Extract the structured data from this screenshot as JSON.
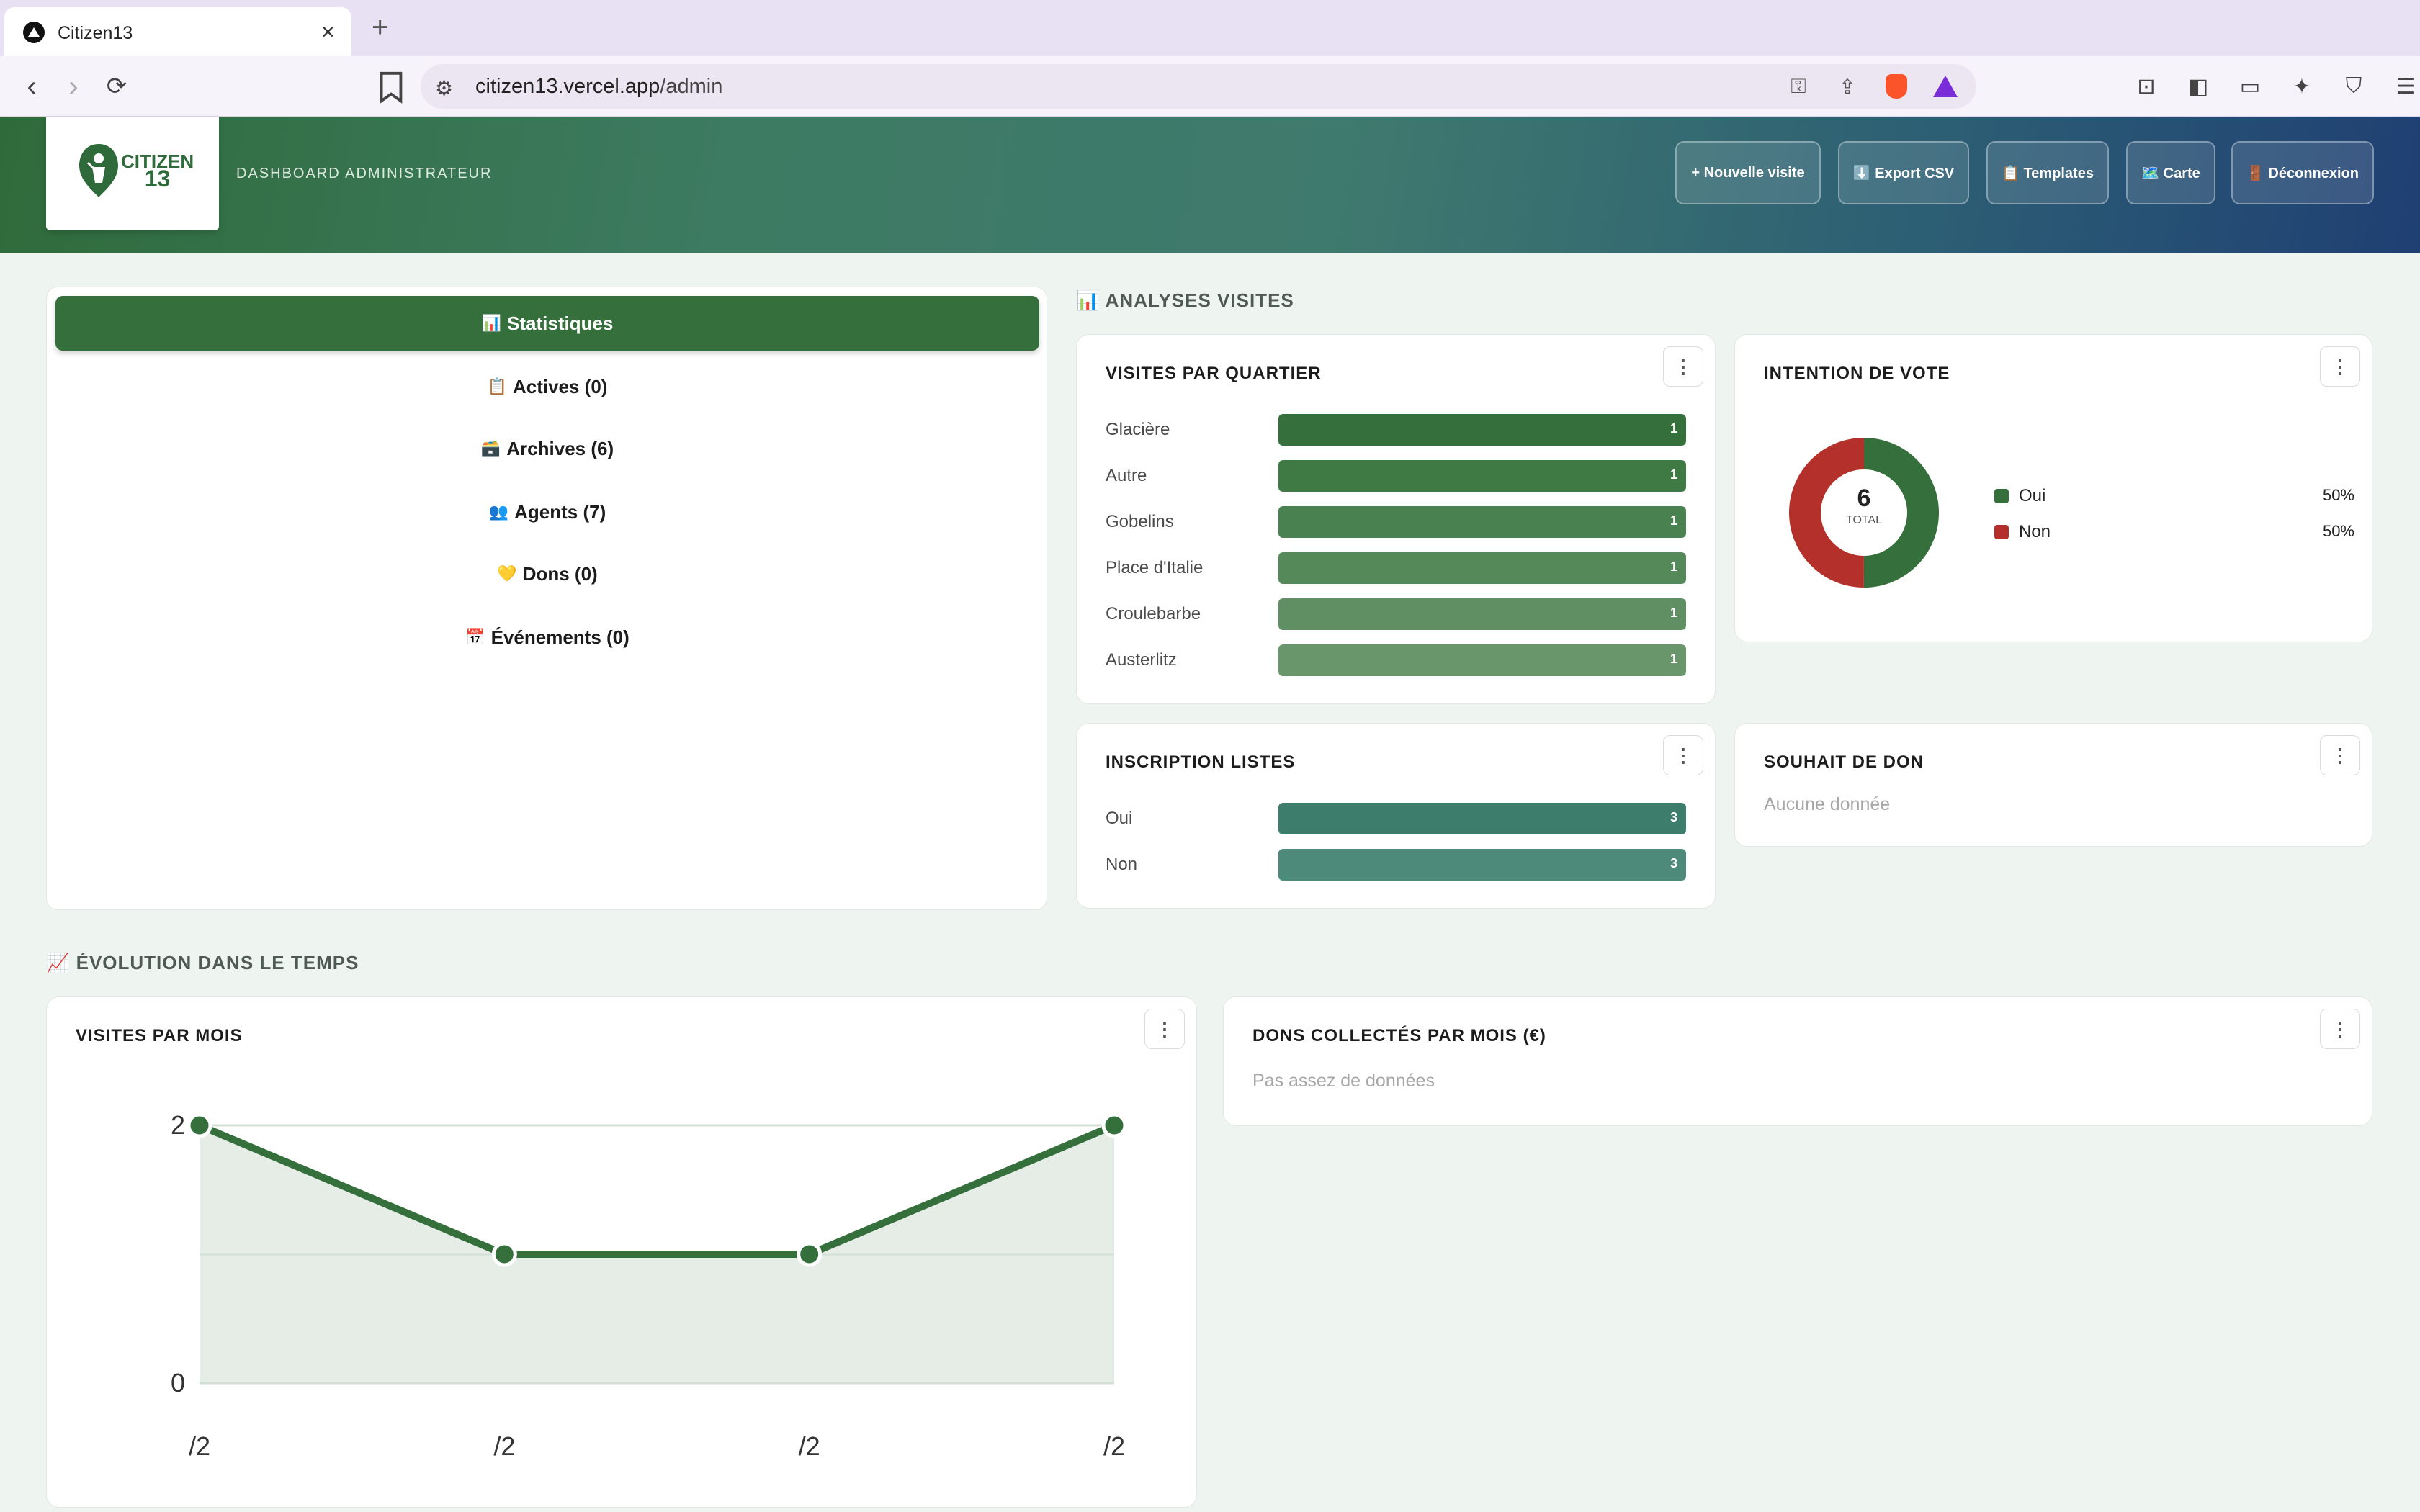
{
  "browser": {
    "tab_title": "Citizen13",
    "url_host": "citizen13.vercel.app",
    "url_path": "/admin"
  },
  "header": {
    "logo_line1": "CITIZEN",
    "logo_line2": "13",
    "subtitle": "DASHBOARD ADMINISTRATEUR",
    "buttons": [
      {
        "label": "+ Nouvelle visite"
      },
      {
        "label": "⬇️ Export CSV"
      },
      {
        "label": "📋 Templates"
      },
      {
        "label": "🗺️ Carte"
      },
      {
        "label": "🚪 Déconnexion"
      }
    ]
  },
  "sidebar": {
    "items": [
      {
        "icon": "📊",
        "label": "Statistiques",
        "active": true
      },
      {
        "icon": "📋",
        "label": "Actives (0)"
      },
      {
        "icon": "🗃️",
        "label": "Archives (6)"
      },
      {
        "icon": "👥",
        "label": "Agents (7)"
      },
      {
        "icon": "💛",
        "label": "Dons (0)"
      },
      {
        "icon": "📅",
        "label": "Événements (0)"
      }
    ]
  },
  "analyses": {
    "icon": "📊",
    "title": "ANALYSES VISITES",
    "visites_quartier": {
      "title": "VISITES PAR QUARTIER",
      "rows": [
        {
          "label": "Glacière",
          "value": 1,
          "color": "#35703c"
        },
        {
          "label": "Autre",
          "value": 1,
          "color": "#3f7a45"
        },
        {
          "label": "Gobelins",
          "value": 1,
          "color": "#4a8150"
        },
        {
          "label": "Place d'Italie",
          "value": 1,
          "color": "#55895a"
        },
        {
          "label": "Croulebarbe",
          "value": 1,
          "color": "#5f8f63"
        },
        {
          "label": "Austerlitz",
          "value": 1,
          "color": "#6a966c"
        }
      ]
    },
    "intention_vote": {
      "title": "INTENTION DE VOTE",
      "total": "6",
      "total_label": "TOTAL",
      "slices": [
        {
          "label": "Oui",
          "pct": "50%",
          "value": 50,
          "color": "#35703c"
        },
        {
          "label": "Non",
          "pct": "50%",
          "value": 50,
          "color": "#b3302b"
        }
      ]
    },
    "inscription_listes": {
      "title": "INSCRIPTION LISTES",
      "rows": [
        {
          "label": "Oui",
          "value": 3,
          "color": "#3c7d6c"
        },
        {
          "label": "Non",
          "value": 3,
          "color": "#4d8a7a"
        }
      ]
    },
    "souhait_don": {
      "title": "SOUHAIT DE DON",
      "empty": "Aucune donnée"
    }
  },
  "evolution": {
    "icon": "📈",
    "title": "ÉVOLUTION DANS LE TEMPS",
    "visites_mois_title": "VISITES PAR MOIS",
    "dons_title": "DONS COLLECTÉS PAR MOIS (€)",
    "dons_empty": "Pas assez de données"
  },
  "chart_data": {
    "type": "area",
    "title": "VISITES PAR MOIS",
    "categories": [
      "/2",
      "/2",
      "/2",
      "/2"
    ],
    "values": [
      2,
      1,
      1,
      2
    ],
    "yticks": [
      "2",
      "0"
    ],
    "ylim": [
      0,
      2
    ],
    "line_color": "#35703c",
    "fill_color": "#e6ede7",
    "grid": true
  }
}
